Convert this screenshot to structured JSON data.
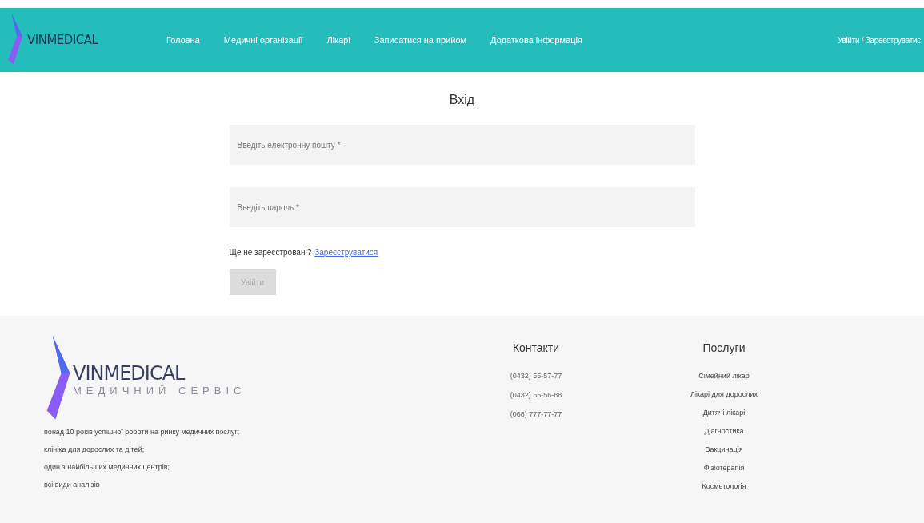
{
  "header": {
    "logo": "VINMEDICAL",
    "nav": [
      "Головна",
      "Медичні організації",
      "Лікарі",
      "Записатися на прийом",
      "Додаткова інформація"
    ],
    "auth_link": "Увійти / Зареєструватис"
  },
  "login": {
    "title": "Вхід",
    "fields": [
      {
        "placeholder": "Введіть електронну пошту *"
      },
      {
        "placeholder": "Введіть пароль *"
      }
    ],
    "register_prompt": "Ще не зареєстровані?",
    "register_link": "Зареєструватися",
    "submit": {
      "label": "Увійти",
      "disabled": true
    }
  },
  "footer": {
    "logo": {
      "name": "VINMEDICAL",
      "tagline": "МЕДИЧНИЙ СЕРВІС"
    },
    "about": [
      "понад 10 років успішної роботи на ринку медичних послуг;",
      "клініка для дорослих та дітей;",
      "один з найбільших медичних центрів;",
      "всі види аналізів"
    ],
    "contacts": {
      "title": "Контакти",
      "phones": [
        "(0432) 55-57-77",
        "(0432) 55-56-88",
        "(068) 777-77-77"
      ]
    },
    "services": {
      "title": "Послуги",
      "items": [
        "Сімейний лікар",
        "Лікарі для дорослих",
        "Дитячі лікарі",
        "Діагностика",
        "Вакцинація",
        "Фізіотерапія",
        "Косметологія"
      ]
    }
  }
}
